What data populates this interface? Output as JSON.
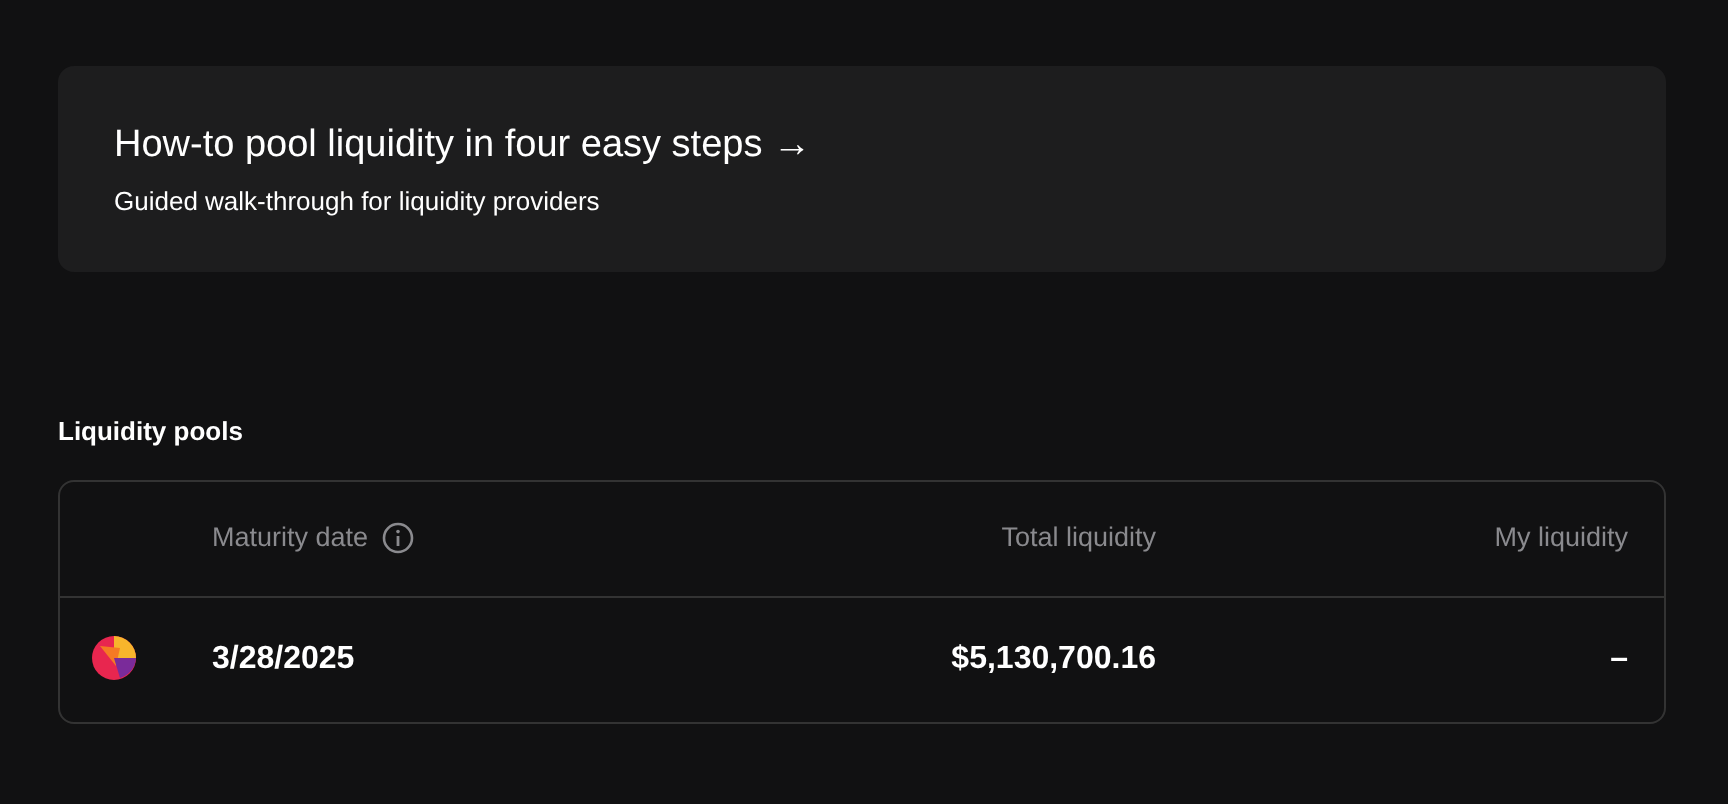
{
  "promo": {
    "title": "How-to pool liquidity in four easy steps →",
    "subtitle": "Guided walk-through for liquidity providers"
  },
  "section_title": "Liquidity pools",
  "table": {
    "columns": [
      {
        "label": "Maturity date",
        "info": true
      },
      {
        "label": "Total liquidity",
        "info": false
      },
      {
        "label": "My liquidity",
        "info": false
      }
    ],
    "rows": [
      {
        "cells": [
          "3/28/2025",
          "$5,130,700.16",
          "–"
        ]
      }
    ]
  }
}
